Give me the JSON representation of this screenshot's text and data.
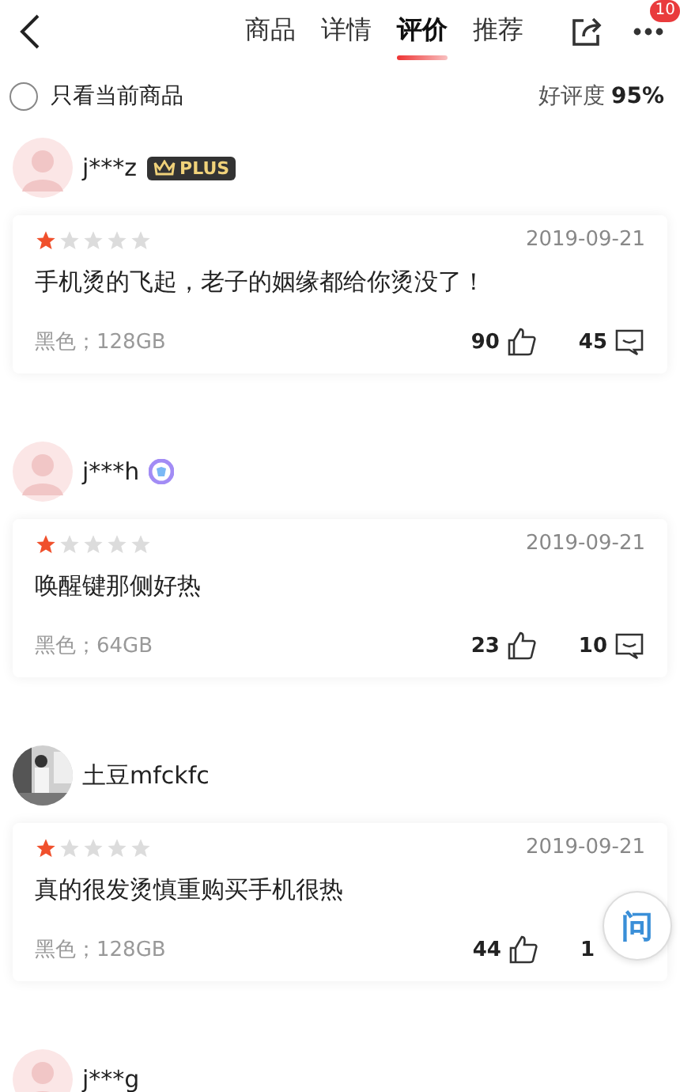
{
  "nav": {
    "tabs": [
      {
        "label": "商品",
        "selected": false
      },
      {
        "label": "详情",
        "selected": false
      },
      {
        "label": "评价",
        "selected": true
      },
      {
        "label": "推荐",
        "selected": false
      }
    ],
    "more_badge": "10"
  },
  "filter": {
    "label": "只看当前商品",
    "checked": false,
    "rating_label": "好评度",
    "rating_value": "95%"
  },
  "reviews": [
    {
      "user": "j***z",
      "avatar": {
        "kind": "default"
      },
      "comment_icon": true,
      "badge": {
        "kind": "plus",
        "text": "PLUS"
      },
      "stars": 1,
      "date": "2019-09-21",
      "text": "手机烫的飞起，老子的姻缘都给你烫没了！",
      "variant": "黑色；128GB",
      "likes": "90",
      "comments": "45"
    },
    {
      "user": "j***h",
      "avatar": {
        "kind": "default"
      },
      "comment_icon": true,
      "badge": {
        "kind": "medal"
      },
      "stars": 1,
      "date": "2019-09-21",
      "text": "唤醒键那侧好热",
      "variant": "黑色；64GB",
      "likes": "23",
      "comments": "10"
    },
    {
      "user": "土豆mfckfc",
      "comment_icon": false,
      "stars": 1,
      "date": "2019-09-21",
      "text": "真的很发烫慎重购买手机很热",
      "variant": "黑色；128GB",
      "likes": "44",
      "comments": "1"
    },
    {
      "user": "j***g",
      "avatar": {
        "kind": "default"
      }
    }
  ],
  "ask_button": "问"
}
